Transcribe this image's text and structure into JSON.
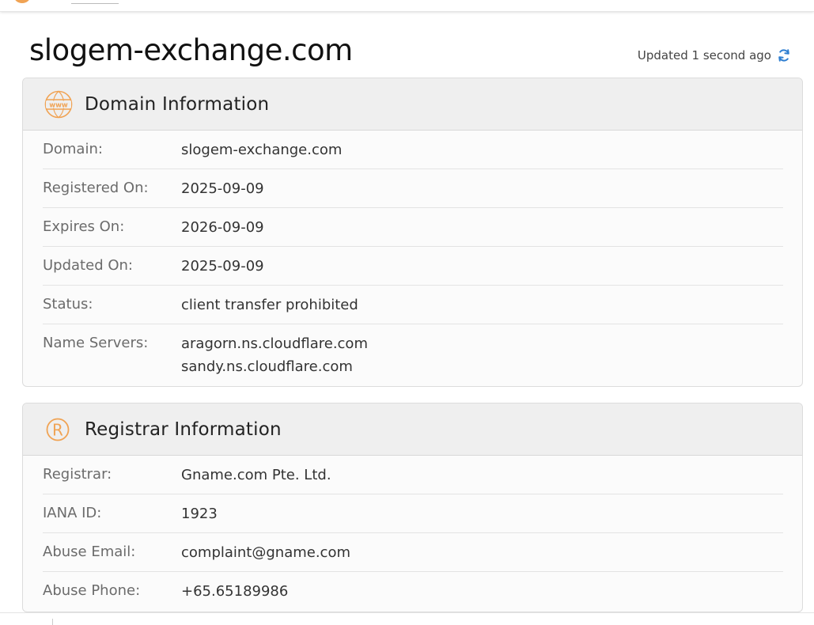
{
  "page": {
    "title": "slogem-exchange.com",
    "updated_text": "Updated 1 second ago"
  },
  "colors": {
    "accent_orange": "#f0a354",
    "refresh_blue": "#2f7fd1",
    "card_header_bg": "#efefef"
  },
  "icons": {
    "domain_section": "www-globe-icon",
    "registrar_section": "registered-trademark-icon",
    "refresh": "refresh-icon"
  },
  "domain_info": {
    "heading": "Domain Information",
    "rows": [
      {
        "label": "Domain:",
        "value": "slogem-exchange.com"
      },
      {
        "label": "Registered On:",
        "value": "2025-09-09"
      },
      {
        "label": "Expires On:",
        "value": "2026-09-09"
      },
      {
        "label": "Updated On:",
        "value": "2025-09-09"
      },
      {
        "label": "Status:",
        "value": "client transfer prohibited"
      }
    ],
    "name_servers": {
      "label": "Name Servers:",
      "values": [
        "aragorn.ns.cloudflare.com",
        "sandy.ns.cloudflare.com"
      ]
    }
  },
  "registrar_info": {
    "heading": "Registrar Information",
    "rows": [
      {
        "label": "Registrar:",
        "value": "Gname.com Pte. Ltd."
      },
      {
        "label": "IANA ID:",
        "value": "1923"
      },
      {
        "label": "Abuse Email:",
        "value": "complaint@gname.com"
      },
      {
        "label": "Abuse Phone:",
        "value": "+65.65189986"
      }
    ]
  }
}
